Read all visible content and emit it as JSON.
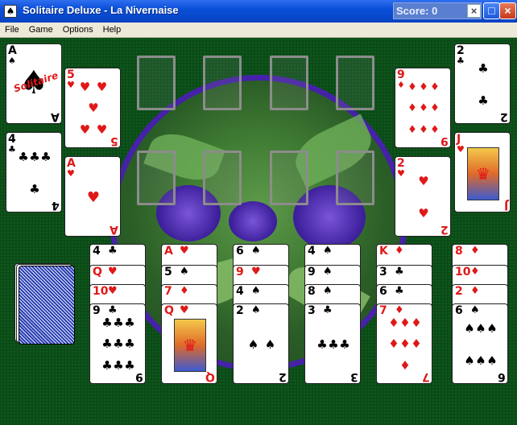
{
  "window": {
    "title": "Solitaire Deluxe - La Nivernaise",
    "score_label": "Score: 0",
    "score_close": "×",
    "minimize": "_",
    "maximize": "□",
    "close": "×"
  },
  "menu": [
    "File",
    "Game",
    "Options",
    "Help"
  ],
  "ace_brand": "Solitaire",
  "colors": {
    "felt": "#0b4a17",
    "ring": "#4522a8",
    "red_suit": "#e01818"
  },
  "reserve_left": [
    {
      "rank": "A",
      "suit": "♠"
    },
    {
      "rank": "4",
      "suit": "♣"
    }
  ],
  "stock_left": [
    {
      "rank": "5",
      "suit": "♥"
    },
    {
      "rank": "A",
      "suit": "♥"
    }
  ],
  "stock_right": [
    {
      "rank": "9",
      "suit": "♦"
    },
    {
      "rank": "2",
      "suit": "♥"
    }
  ],
  "reserve_right": [
    {
      "rank": "2",
      "suit": "♣"
    },
    {
      "rank": "J",
      "suit": "♥"
    }
  ],
  "tableau": [
    [
      {
        "rank": "4",
        "suit": "♣"
      },
      {
        "rank": "Q",
        "suit": "♥"
      },
      {
        "rank": "10",
        "suit": "♥"
      },
      {
        "rank": "9",
        "suit": "♣"
      }
    ],
    [
      {
        "rank": "A",
        "suit": "♥"
      },
      {
        "rank": "5",
        "suit": "♠"
      },
      {
        "rank": "7",
        "suit": "♦"
      },
      {
        "rank": "Q",
        "suit": "♥"
      }
    ],
    [
      {
        "rank": "6",
        "suit": "♠"
      },
      {
        "rank": "9",
        "suit": "♥"
      },
      {
        "rank": "4",
        "suit": "♠"
      },
      {
        "rank": "2",
        "suit": "♠"
      }
    ],
    [
      {
        "rank": "4",
        "suit": "♠"
      },
      {
        "rank": "9",
        "suit": "♠"
      },
      {
        "rank": "8",
        "suit": "♠"
      },
      {
        "rank": "3",
        "suit": "♣"
      }
    ],
    [
      {
        "rank": "K",
        "suit": "♦"
      },
      {
        "rank": "3",
        "suit": "♣"
      },
      {
        "rank": "6",
        "suit": "♣"
      },
      {
        "rank": "7",
        "suit": "♦"
      }
    ],
    [
      {
        "rank": "8",
        "suit": "♦"
      },
      {
        "rank": "10",
        "suit": "♦"
      },
      {
        "rank": "2",
        "suit": "♦"
      },
      {
        "rank": "6",
        "suit": "♠"
      }
    ]
  ]
}
